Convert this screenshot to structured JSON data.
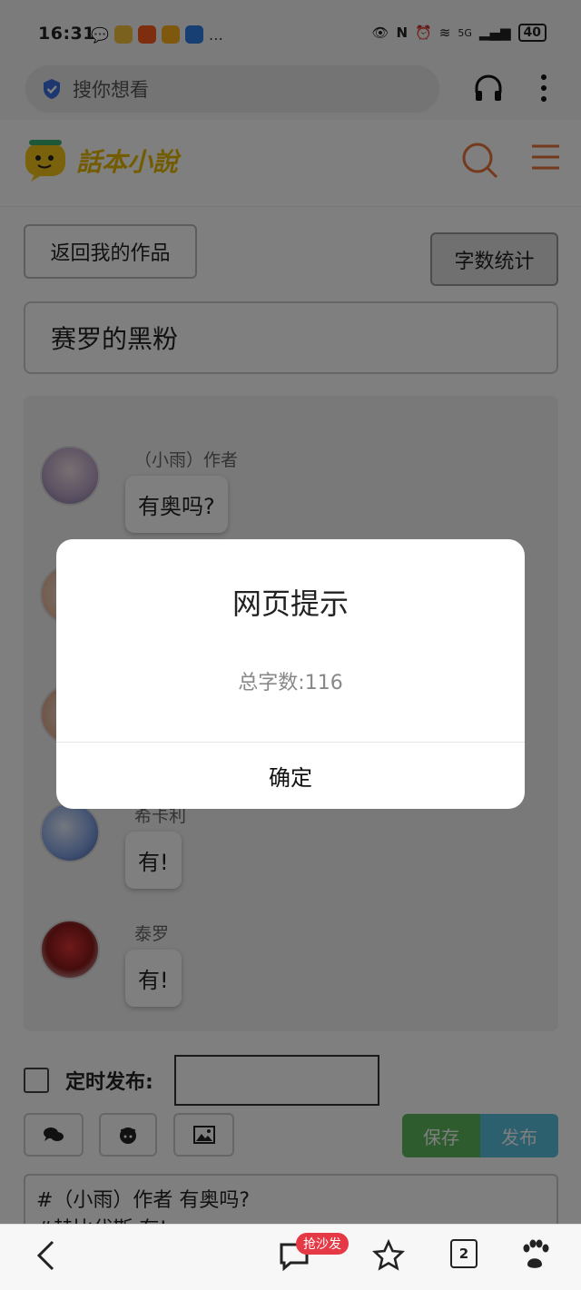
{
  "status_bar": {
    "time": "16:31",
    "network": "5G",
    "battery": "40"
  },
  "browser": {
    "search_placeholder": "搜你想看"
  },
  "site": {
    "logo_text": "話本小說"
  },
  "editor": {
    "back_button": "返回我的作品",
    "wordcount_button": "字数统计",
    "title_value": "赛罗的黑粉",
    "messages": [
      {
        "name": "（小雨）作者",
        "text": "有奥吗?"
      },
      {
        "name": "",
        "text": ""
      },
      {
        "name": "",
        "text": ""
      },
      {
        "name": "希卡利",
        "text": "有!"
      },
      {
        "name": "泰罗",
        "text": "有!"
      }
    ],
    "schedule_label": "定时发布:",
    "save_button": "保存",
    "publish_button": "发布",
    "textarea_line1": "#（小雨）作者 有奥吗?",
    "textarea_line2": "#赫比代斯 有!"
  },
  "dialog": {
    "title": "网页提示",
    "message": "总字数:116",
    "ok_button": "确定"
  },
  "bottom_nav": {
    "badge": "抢沙发",
    "tab_count": "2"
  },
  "colors": {
    "save_green": "#5cb85c",
    "publish_blue": "#5bc0de",
    "accent_orange": "#e8743b",
    "logo_yellow": "#e6b800",
    "badge_red": "#e63946"
  }
}
